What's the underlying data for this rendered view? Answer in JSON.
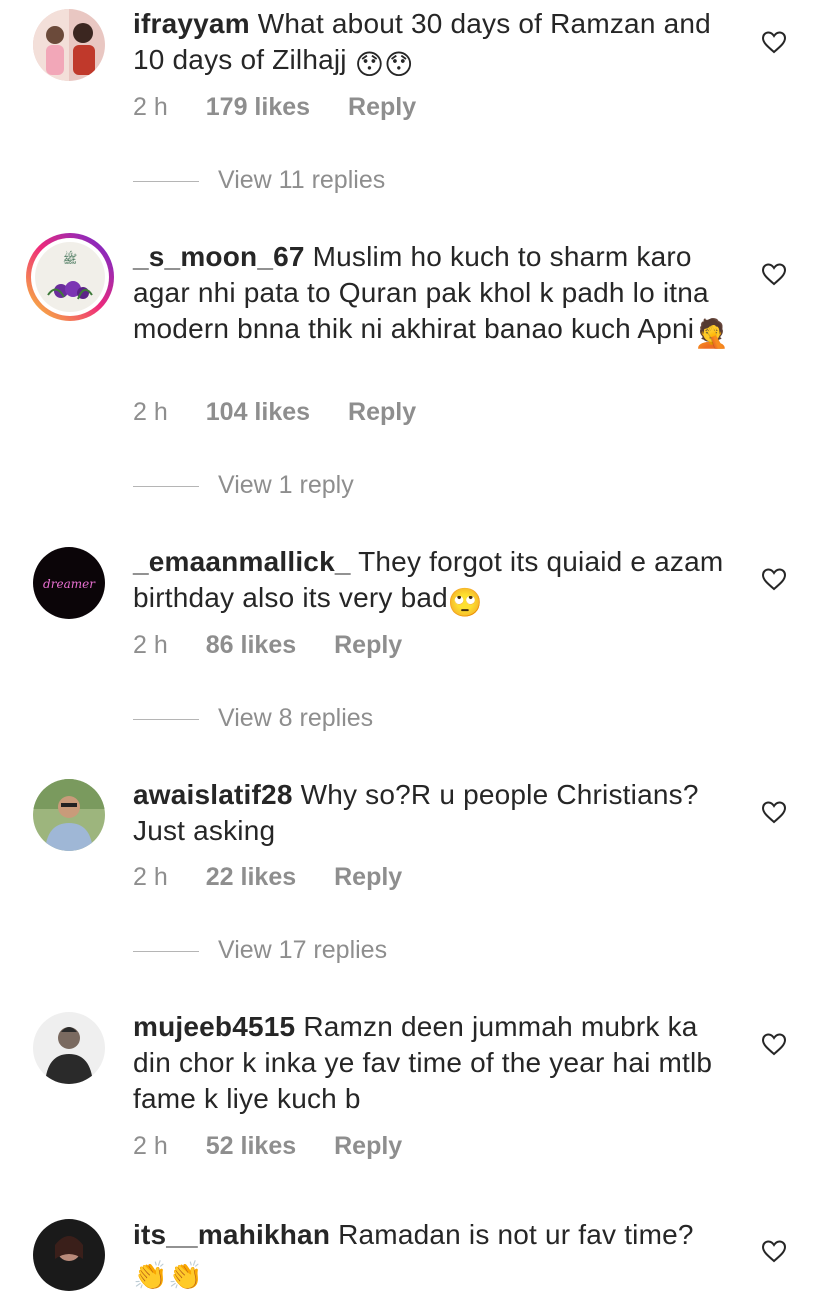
{
  "comments": [
    {
      "username": "ifrayyam",
      "text": "What about 30 days of Ramzan and 10 days of Zilhajj",
      "emoji": "😯😯",
      "time": "2 h",
      "likes": "179 likes",
      "reply": "Reply",
      "view_replies": "View 11 replies"
    },
    {
      "username": "_s_moon_67",
      "text": "Muslim ho kuch to sharm karo agar nhi pata to Quran pak khol k padh lo itna modern bnna thik ni akhirat banao kuch Apni",
      "emoji": "🤦",
      "time": "2 h",
      "likes": "104 likes",
      "reply": "Reply",
      "view_replies": "View 1 reply"
    },
    {
      "username": "_emaanmallick_",
      "text": "They forgot its quiaid e azam birthday also its very bad",
      "emoji": "🙄",
      "avatar_text": "dreamer",
      "time": "2 h",
      "likes": "86 likes",
      "reply": "Reply",
      "view_replies": "View 8 replies"
    },
    {
      "username": "awaislatif28",
      "text": "Why so?R u people Christians? Just asking",
      "time": "2 h",
      "likes": "22 likes",
      "reply": "Reply",
      "view_replies": "View 17 replies"
    },
    {
      "username": "mujeeb4515",
      "text": "Ramzn deen jummah mubrk ka din chor k inka ye fav time of the year hai mtlb fame k liye kuch b",
      "time": "2 h",
      "likes": "52 likes",
      "reply": "Reply"
    },
    {
      "username": "its__mahikhan",
      "text": "Ramadan is not ur fav time?",
      "emoji": "👏👏"
    }
  ]
}
